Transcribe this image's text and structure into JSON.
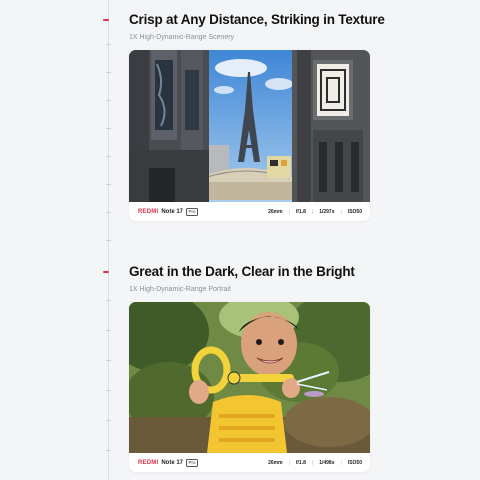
{
  "sections": [
    {
      "title": "Crisp at Any Distance, Striking in Texture",
      "subtitle": "1X High-Dynamic-Range Scenery",
      "caption": {
        "brand": "REDMI",
        "model": "Note 17",
        "badge": "Pro",
        "specs": [
          "26mm",
          "f/1.8",
          "1/297s",
          "ISO50"
        ]
      }
    },
    {
      "title": "Great in the Dark, Clear in the Bright",
      "subtitle": "1X High-Dynamic-Range Portrait",
      "caption": {
        "brand": "REDMI",
        "model": "Note 17",
        "badge": "Pro",
        "specs": [
          "26mm",
          "f/1.8",
          "1/498s",
          "ISO50"
        ]
      }
    }
  ],
  "colors": {
    "accent": "#e0304a",
    "background": "#f4f5f7",
    "timeline": "#dcdfe4"
  }
}
